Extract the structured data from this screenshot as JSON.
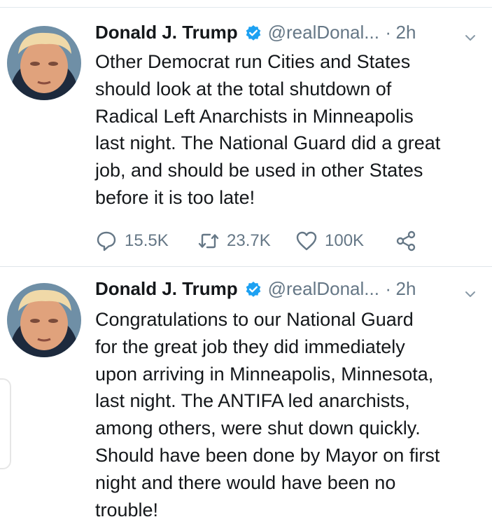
{
  "tweets": [
    {
      "name": "Donald J. Trump",
      "handle": "@realDonal...",
      "separator": "·",
      "time": "2h",
      "text": "Other Democrat run Cities and States\nshould look at the total shutdown of\nRadical Left Anarchists in Minneapolis\nlast night. The National Guard did a great\njob, and should be used in other States\nbefore it is too late!",
      "replies": "15.5K",
      "retweets": "23.7K",
      "likes": "100K"
    },
    {
      "name": "Donald J. Trump",
      "handle": "@realDonal...",
      "separator": "·",
      "time": "2h",
      "text": "Congratulations to our National Guard\nfor the great job they did immediately\nupon arriving in Minneapolis, Minnesota,\nlast night. The ANTIFA led anarchists,\namong others, were shut down quickly.\nShould have been done by Mayor on first\nnight and there would have been no\ntrouble!"
    }
  ],
  "icons": {
    "verified": "verified-badge-icon",
    "menu": "chevron-down-icon",
    "reply": "reply-icon",
    "retweet": "retweet-icon",
    "like": "heart-icon",
    "share": "share-icon"
  },
  "colors": {
    "verified": "#1da1f2",
    "secondary_text": "#657786",
    "primary_text": "#14171a",
    "divider": "#e1e8ed"
  }
}
